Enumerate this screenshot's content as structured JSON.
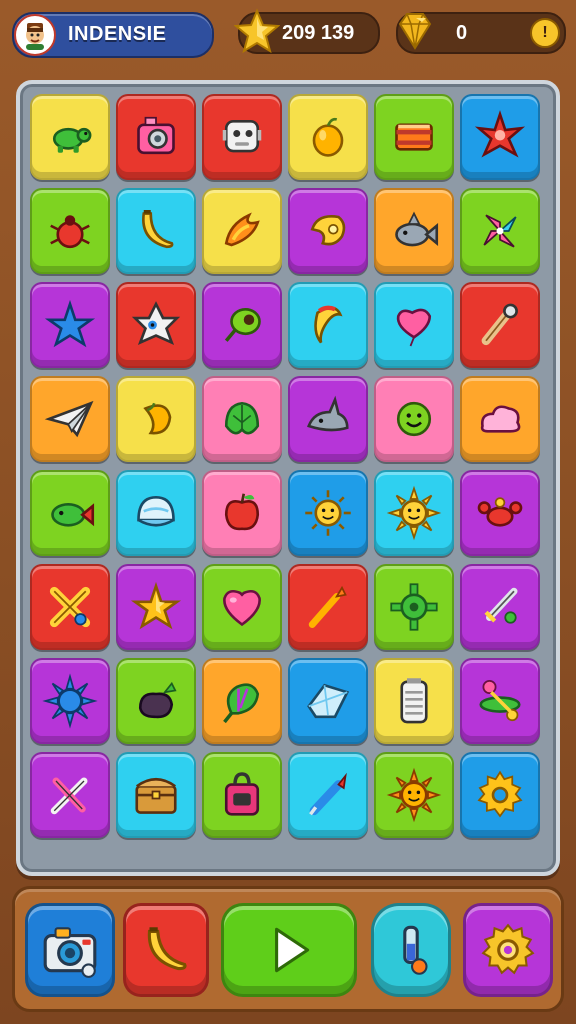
{
  "player": {
    "name": "INDENSIE",
    "avatar_icon": "avatar-icon"
  },
  "currency": {
    "coins": {
      "value": "209 139",
      "icon": "star-icon",
      "color": "#f7c52a"
    },
    "gems": {
      "value": "0",
      "icon": "gem-icon",
      "add_label": "!"
    }
  },
  "board": {
    "rows": 8,
    "cols": 6,
    "tiles": [
      [
        {
          "bg": "#f6e04a",
          "icon": "turtle-icon"
        },
        {
          "bg": "#e8372d",
          "icon": "camera-icon"
        },
        {
          "bg": "#e8372d",
          "icon": "robot-icon"
        },
        {
          "bg": "#f6e04a",
          "icon": "orange-icon"
        },
        {
          "bg": "#7ed321",
          "icon": "drum-icon"
        },
        {
          "bg": "#1f9de8",
          "icon": "red-star-icon"
        }
      ],
      [
        {
          "bg": "#7ed321",
          "icon": "beetle-icon"
        },
        {
          "bg": "#2fd0f0",
          "icon": "banana-icon"
        },
        {
          "bg": "#f6e04a",
          "icon": "flame-icon"
        },
        {
          "bg": "#b635d8",
          "icon": "horn-icon"
        },
        {
          "bg": "#ffa62b",
          "icon": "fish-icon"
        },
        {
          "bg": "#7ed321",
          "icon": "pinwheel-icon"
        }
      ],
      [
        {
          "bg": "#b635d8",
          "icon": "starfish-icon"
        },
        {
          "bg": "#e8372d",
          "icon": "ghost-star-icon"
        },
        {
          "bg": "#b635d8",
          "icon": "bean-icon"
        },
        {
          "bg": "#2fd0f0",
          "icon": "pepper-icon"
        },
        {
          "bg": "#2fd0f0",
          "icon": "heart-balloon-icon"
        },
        {
          "bg": "#e8372d",
          "icon": "bat-icon"
        }
      ],
      [
        {
          "bg": "#ffa62b",
          "icon": "paper-plane-icon"
        },
        {
          "bg": "#f6e04a",
          "icon": "mango-icon"
        },
        {
          "bg": "#ff7fb5",
          "icon": "leaf-icon"
        },
        {
          "bg": "#b635d8",
          "icon": "shark-icon"
        },
        {
          "bg": "#ff7fb5",
          "icon": "smiley-icon"
        },
        {
          "bg": "#ffa62b",
          "icon": "cloud-icon"
        }
      ],
      [
        {
          "bg": "#7ed321",
          "icon": "fish-green-icon"
        },
        {
          "bg": "#2fd0f0",
          "icon": "dome-icon"
        },
        {
          "bg": "#ff7fb5",
          "icon": "apple-icon"
        },
        {
          "bg": "#1f9de8",
          "icon": "sun-face-icon"
        },
        {
          "bg": "#2fd0f0",
          "icon": "sun-icon"
        },
        {
          "bg": "#b635d8",
          "icon": "crab-icon"
        }
      ],
      [
        {
          "bg": "#e8372d",
          "icon": "cross-swords-icon"
        },
        {
          "bg": "#b635d8",
          "icon": "gold-star-icon"
        },
        {
          "bg": "#7ed321",
          "icon": "heart-icon"
        },
        {
          "bg": "#e8372d",
          "icon": "torch-icon"
        },
        {
          "bg": "#7ed321",
          "icon": "gear-ball-icon"
        },
        {
          "bg": "#b635d8",
          "icon": "sword-icon"
        }
      ],
      [
        {
          "bg": "#b635d8",
          "icon": "spiky-ball-icon"
        },
        {
          "bg": "#7ed321",
          "icon": "eggplant-icon"
        },
        {
          "bg": "#ffa62b",
          "icon": "lettuce-icon"
        },
        {
          "bg": "#1f9de8",
          "icon": "crystal-icon"
        },
        {
          "bg": "#f6e04a",
          "icon": "battery-icon"
        },
        {
          "bg": "#b635d8",
          "icon": "saturn-icon"
        }
      ],
      [
        {
          "bg": "#b635d8",
          "icon": "crossed-sticks-icon"
        },
        {
          "bg": "#2fd0f0",
          "icon": "chest-icon"
        },
        {
          "bg": "#7ed321",
          "icon": "bag-icon"
        },
        {
          "bg": "#2fd0f0",
          "icon": "pen-icon"
        },
        {
          "bg": "#7ed321",
          "icon": "sun-orange-icon"
        },
        {
          "bg": "#1f9de8",
          "icon": "gear-icon"
        }
      ]
    ]
  },
  "bottom_bar": [
    {
      "name": "camera-button",
      "icon": "camera-icon",
      "bg": "#1f7fd8"
    },
    {
      "name": "banana-button",
      "icon": "banana-icon",
      "bg": "#e8372d"
    },
    {
      "name": "play-button",
      "icon": "play-icon",
      "bg": "#5fce1a"
    },
    {
      "name": "potion-button",
      "icon": "potion-icon",
      "bg": "#2fc8d8"
    },
    {
      "name": "settings-button",
      "icon": "settings-gear-icon",
      "bg": "#b635d8"
    }
  ]
}
